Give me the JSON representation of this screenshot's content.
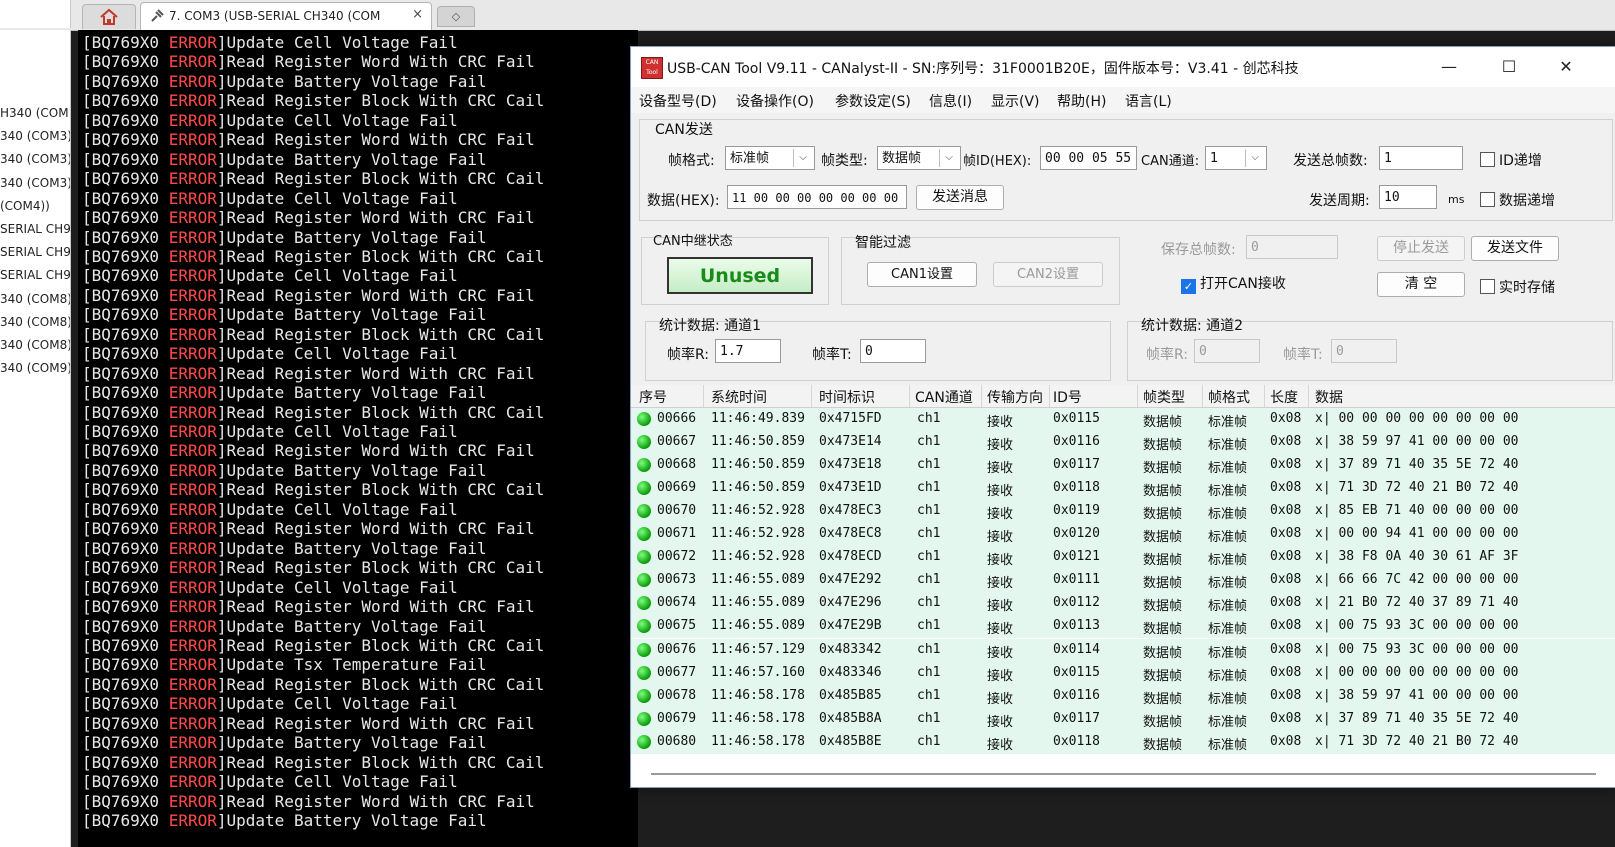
{
  "tabs": {
    "active_label": "7. COM3  (USB-SERIAL CH340 (COM",
    "close": "×",
    "new_tab": "◇"
  },
  "sessions": [
    "H340 (COM1",
    "340 (COM3)",
    "340 (COM3)",
    "340 (COM3)",
    " (COM4))",
    "SERIAL CH9:",
    "SERIAL CH9:",
    "SERIAL CH9:",
    "340 (COM8)",
    "340 (COM8)",
    "340 (COM8)",
    "340 (COM9)"
  ],
  "terminal": {
    "prefix": "[BQ769X0 ",
    "error": "ERROR",
    "lines": [
      "]Update Cell Voltage Fail",
      "]Read Register Word With CRC Fail",
      "]Update Battery Voltage Fail",
      "]Read Register Block With CRC Cail",
      "]Update Cell Voltage Fail",
      "]Read Register Word With CRC Fail",
      "]Update Battery Voltage Fail",
      "]Read Register Block With CRC Cail",
      "]Update Cell Voltage Fail",
      "]Read Register Word With CRC Fail",
      "]Update Battery Voltage Fail",
      "]Read Register Block With CRC Cail",
      "]Update Cell Voltage Fail",
      "]Read Register Word With CRC Fail",
      "]Update Battery Voltage Fail",
      "]Read Register Block With CRC Cail",
      "]Update Cell Voltage Fail",
      "]Read Register Word With CRC Fail",
      "]Update Battery Voltage Fail",
      "]Read Register Block With CRC Cail",
      "]Update Cell Voltage Fail",
      "]Read Register Word With CRC Fail",
      "]Update Battery Voltage Fail",
      "]Read Register Block With CRC Cail",
      "]Update Cell Voltage Fail",
      "]Read Register Word With CRC Fail",
      "]Update Battery Voltage Fail",
      "]Read Register Block With CRC Cail",
      "]Update Cell Voltage Fail",
      "]Read Register Word With CRC Fail",
      "]Update Battery Voltage Fail",
      "]Read Register Block With CRC Cail",
      "]Update Tsx Temperature Fail",
      "]Read Register Block With CRC Cail",
      "]Update Cell Voltage Fail",
      "]Read Register Word With CRC Fail",
      "]Update Battery Voltage Fail",
      "]Read Register Block With CRC Cail",
      "]Update Cell Voltage Fail",
      "]Read Register Word With CRC Fail",
      "]Update Battery Voltage Fail"
    ]
  },
  "can": {
    "logo": "CAN Tool",
    "title": "USB-CAN Tool V9.11 - CANalyst-II - SN:序列号：31F0001B20E，固件版本号：V3.41 - 创芯科技",
    "win_min": "—",
    "win_max": "☐",
    "win_close": "✕",
    "menu": [
      "设备型号(D)",
      "设备操作(O)",
      "参数设定(S)",
      "信息(I)",
      "显示(V)",
      "帮助(H)",
      "语言(L)"
    ],
    "send": {
      "section": "CAN发送",
      "frame_format_label": "帧格式:",
      "frame_format": "标准帧",
      "frame_type_label": "帧类型:",
      "frame_type": "数据帧",
      "frame_id_label": "帧ID(HEX):",
      "frame_id": "00 00 05 55",
      "channel_label": "CAN通道:",
      "channel": "1",
      "total_label": "发送总帧数:",
      "total": "1",
      "id_inc": "ID递增",
      "data_label": "数据(HEX):",
      "data": "11 00 00 00 00 00 00 00",
      "send_btn": "发送消息",
      "period_label": "发送周期:",
      "period": "10",
      "period_unit": "ms",
      "data_inc": "数据递增"
    },
    "relay": {
      "label": "CAN中继状态",
      "status": "Unused"
    },
    "filter": {
      "label": "智能过滤",
      "can1": "CAN1设置",
      "can2": "CAN2设置"
    },
    "save": {
      "total_label": "保存总帧数:",
      "total": "0",
      "open_recv": "打开CAN接收",
      "stop_send": "停止发送",
      "send_file": "发送文件",
      "clear": "清  空",
      "realtime": "实时存储"
    },
    "stats1": {
      "label": "统计数据: 通道1",
      "rate_r_label": "帧率R:",
      "rate_r": "1.7",
      "rate_t_label": "帧率T:",
      "rate_t": "0"
    },
    "stats2": {
      "label": "统计数据: 通道2",
      "rate_r_label": "帧率R:",
      "rate_r": "0",
      "rate_t_label": "帧率T:",
      "rate_t": "0"
    },
    "table": {
      "headers": [
        "序号",
        "系统时间",
        "时间标识",
        "CAN通道",
        "传输方向",
        "ID号",
        "帧类型",
        "帧格式",
        "长度",
        "数据"
      ],
      "rows": [
        [
          "00666",
          "11:46:49.839",
          "0x4715FD",
          "ch1",
          "接收",
          "0x0115",
          "数据帧",
          "标准帧",
          "0x08",
          "x| 00 00 00 00 00 00 00 00"
        ],
        [
          "00667",
          "11:46:50.859",
          "0x473E14",
          "ch1",
          "接收",
          "0x0116",
          "数据帧",
          "标准帧",
          "0x08",
          "x| 38 59 97 41 00 00 00 00"
        ],
        [
          "00668",
          "11:46:50.859",
          "0x473E18",
          "ch1",
          "接收",
          "0x0117",
          "数据帧",
          "标准帧",
          "0x08",
          "x| 37 89 71 40 35 5E 72 40"
        ],
        [
          "00669",
          "11:46:50.859",
          "0x473E1D",
          "ch1",
          "接收",
          "0x0118",
          "数据帧",
          "标准帧",
          "0x08",
          "x| 71 3D 72 40 21 B0 72 40"
        ],
        [
          "00670",
          "11:46:52.928",
          "0x478EC3",
          "ch1",
          "接收",
          "0x0119",
          "数据帧",
          "标准帧",
          "0x08",
          "x| 85 EB 71 40 00 00 00 00"
        ],
        [
          "00671",
          "11:46:52.928",
          "0x478EC8",
          "ch1",
          "接收",
          "0x0120",
          "数据帧",
          "标准帧",
          "0x08",
          "x| 00 00 94 41 00 00 00 00"
        ],
        [
          "00672",
          "11:46:52.928",
          "0x478ECD",
          "ch1",
          "接收",
          "0x0121",
          "数据帧",
          "标准帧",
          "0x08",
          "x| 38 F8 0A 40 30 61 AF 3F"
        ],
        [
          "00673",
          "11:46:55.089",
          "0x47E292",
          "ch1",
          "接收",
          "0x0111",
          "数据帧",
          "标准帧",
          "0x08",
          "x| 66 66 7C 42 00 00 00 00"
        ],
        [
          "00674",
          "11:46:55.089",
          "0x47E296",
          "ch1",
          "接收",
          "0x0112",
          "数据帧",
          "标准帧",
          "0x08",
          "x| 21 B0 72 40 37 89 71 40"
        ],
        [
          "00675",
          "11:46:55.089",
          "0x47E29B",
          "ch1",
          "接收",
          "0x0113",
          "数据帧",
          "标准帧",
          "0x08",
          "x| 00 75 93 3C 00 00 00 00"
        ],
        [
          "00676",
          "11:46:57.129",
          "0x483342",
          "ch1",
          "接收",
          "0x0114",
          "数据帧",
          "标准帧",
          "0x08",
          "x| 00 75 93 3C 00 00 00 00"
        ],
        [
          "00677",
          "11:46:57.160",
          "0x483346",
          "ch1",
          "接收",
          "0x0115",
          "数据帧",
          "标准帧",
          "0x08",
          "x| 00 00 00 00 00 00 00 00"
        ],
        [
          "00678",
          "11:46:58.178",
          "0x485B85",
          "ch1",
          "接收",
          "0x0116",
          "数据帧",
          "标准帧",
          "0x08",
          "x| 38 59 97 41 00 00 00 00"
        ],
        [
          "00679",
          "11:46:58.178",
          "0x485B8A",
          "ch1",
          "接收",
          "0x0117",
          "数据帧",
          "标准帧",
          "0x08",
          "x| 37 89 71 40 35 5E 72 40"
        ],
        [
          "00680",
          "11:46:58.178",
          "0x485B8E",
          "ch1",
          "接收",
          "0x0118",
          "数据帧",
          "标准帧",
          "0x08",
          "x| 71 3D 72 40 21 B0 72 40"
        ]
      ]
    }
  }
}
